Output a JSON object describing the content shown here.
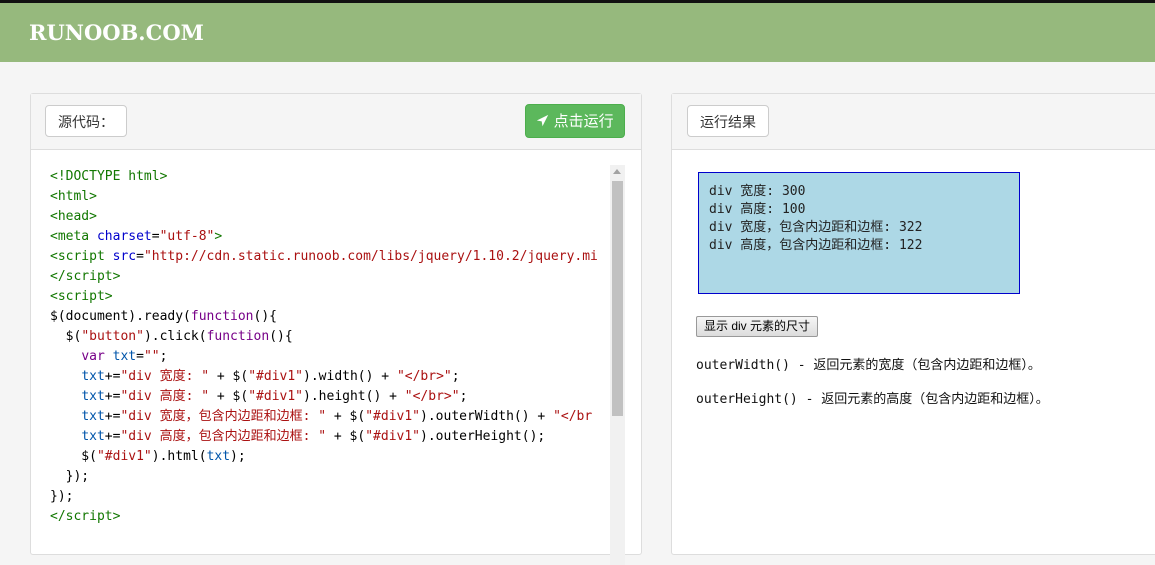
{
  "header": {
    "logo": "RUNOOB.COM"
  },
  "left_panel": {
    "source_label": "源代码：",
    "run_button": "点击运行",
    "run_icon": "paper-plane-icon",
    "code_lines": [
      [
        {
          "t": "tag",
          "s": "<!DOCTYPE html>"
        }
      ],
      [
        {
          "t": "tag",
          "s": "<html>"
        }
      ],
      [
        {
          "t": "tag",
          "s": "<head>"
        }
      ],
      [
        {
          "t": "tag",
          "s": "<meta "
        },
        {
          "t": "attr",
          "s": "charset"
        },
        {
          "t": "plain",
          "s": "="
        },
        {
          "t": "str",
          "s": "\"utf-8\""
        },
        {
          "t": "tag",
          "s": ">"
        }
      ],
      [
        {
          "t": "tag",
          "s": "<script "
        },
        {
          "t": "attr",
          "s": "src"
        },
        {
          "t": "plain",
          "s": "="
        },
        {
          "t": "str",
          "s": "\"http://cdn.static.runoob.com/libs/jquery/1.10.2/jquery.mi"
        }
      ],
      [
        {
          "t": "tag",
          "s": "</script>"
        }
      ],
      [
        {
          "t": "tag",
          "s": "<script>"
        }
      ],
      [
        {
          "t": "plain",
          "s": "$(document).ready("
        },
        {
          "t": "kw",
          "s": "function"
        },
        {
          "t": "plain",
          "s": "(){"
        }
      ],
      [
        {
          "t": "plain",
          "s": "  $("
        },
        {
          "t": "str",
          "s": "\"button\""
        },
        {
          "t": "plain",
          "s": ").click("
        },
        {
          "t": "kw",
          "s": "function"
        },
        {
          "t": "plain",
          "s": "(){"
        }
      ],
      [
        {
          "t": "plain",
          "s": "    "
        },
        {
          "t": "kw",
          "s": "var "
        },
        {
          "t": "var",
          "s": "txt"
        },
        {
          "t": "plain",
          "s": "="
        },
        {
          "t": "str",
          "s": "\"\""
        },
        {
          "t": "plain",
          "s": ";"
        }
      ],
      [
        {
          "t": "plain",
          "s": "    "
        },
        {
          "t": "var",
          "s": "txt"
        },
        {
          "t": "plain",
          "s": "+="
        },
        {
          "t": "str",
          "s": "\"div 宽度: \""
        },
        {
          "t": "plain",
          "s": " + $("
        },
        {
          "t": "str",
          "s": "\"#div1\""
        },
        {
          "t": "plain",
          "s": ").width() + "
        },
        {
          "t": "str",
          "s": "\"</br>\""
        },
        {
          "t": "plain",
          "s": ";"
        }
      ],
      [
        {
          "t": "plain",
          "s": "    "
        },
        {
          "t": "var",
          "s": "txt"
        },
        {
          "t": "plain",
          "s": "+="
        },
        {
          "t": "str",
          "s": "\"div 高度: \""
        },
        {
          "t": "plain",
          "s": " + $("
        },
        {
          "t": "str",
          "s": "\"#div1\""
        },
        {
          "t": "plain",
          "s": ").height() + "
        },
        {
          "t": "str",
          "s": "\"</br>\""
        },
        {
          "t": "plain",
          "s": ";"
        }
      ],
      [
        {
          "t": "plain",
          "s": "    "
        },
        {
          "t": "var",
          "s": "txt"
        },
        {
          "t": "plain",
          "s": "+="
        },
        {
          "t": "str",
          "s": "\"div 宽度，包含内边距和边框: \""
        },
        {
          "t": "plain",
          "s": " + $("
        },
        {
          "t": "str",
          "s": "\"#div1\""
        },
        {
          "t": "plain",
          "s": ").outerWidth() + "
        },
        {
          "t": "str",
          "s": "\"</br"
        }
      ],
      [
        {
          "t": "plain",
          "s": "    "
        },
        {
          "t": "var",
          "s": "txt"
        },
        {
          "t": "plain",
          "s": "+="
        },
        {
          "t": "str",
          "s": "\"div 高度，包含内边距和边框: \""
        },
        {
          "t": "plain",
          "s": " + $("
        },
        {
          "t": "str",
          "s": "\"#div1\""
        },
        {
          "t": "plain",
          "s": ").outerHeight();"
        }
      ],
      [
        {
          "t": "plain",
          "s": "    $("
        },
        {
          "t": "str",
          "s": "\"#div1\""
        },
        {
          "t": "plain",
          "s": ").html("
        },
        {
          "t": "var",
          "s": "txt"
        },
        {
          "t": "plain",
          "s": ");"
        }
      ],
      [
        {
          "t": "plain",
          "s": "  });"
        }
      ],
      [
        {
          "t": "plain",
          "s": "});"
        }
      ],
      [
        {
          "t": "tag",
          "s": "</script>"
        }
      ]
    ]
  },
  "right_panel": {
    "result_label": "运行结果",
    "div1_lines": [
      "div 宽度: 300",
      "div 高度: 100",
      "div 宽度，包含内边距和边框: 322",
      "div 高度，包含内边距和边框: 122"
    ],
    "show_button": "显示 div 元素的尺寸",
    "descriptions": [
      "outerWidth() - 返回元素的宽度（包含内边距和边框）。",
      "outerHeight() - 返回元素的高度（包含内边距和边框）。"
    ]
  },
  "colors": {
    "header_bg": "#96b97d",
    "run_button_bg": "#5cb85c",
    "div1_bg": "#add8e6",
    "div1_border": "#0000cc"
  }
}
